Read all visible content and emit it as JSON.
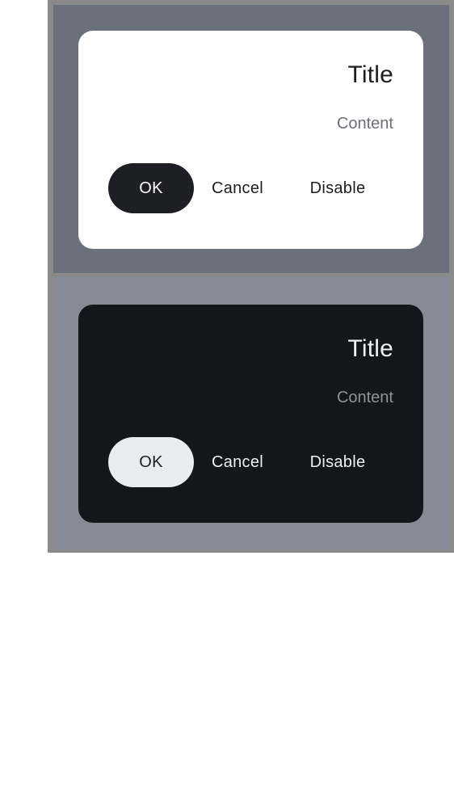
{
  "colors": {
    "light_dialog_bg": "#ffffff",
    "dark_dialog_bg": "#13161b",
    "light_scrim": "#6a717b",
    "dark_scrim": "#858a94",
    "light_ok_bg": "#1d1f24",
    "dark_ok_bg": "#e9ecf1"
  },
  "light_dialog": {
    "title": "Title",
    "content": "Content",
    "ok_label": "OK",
    "cancel_label": "Cancel",
    "disable_label": "Disable"
  },
  "dark_dialog": {
    "title": "Title",
    "content": "Content",
    "ok_label": "OK",
    "cancel_label": "Cancel",
    "disable_label": "Disable"
  }
}
